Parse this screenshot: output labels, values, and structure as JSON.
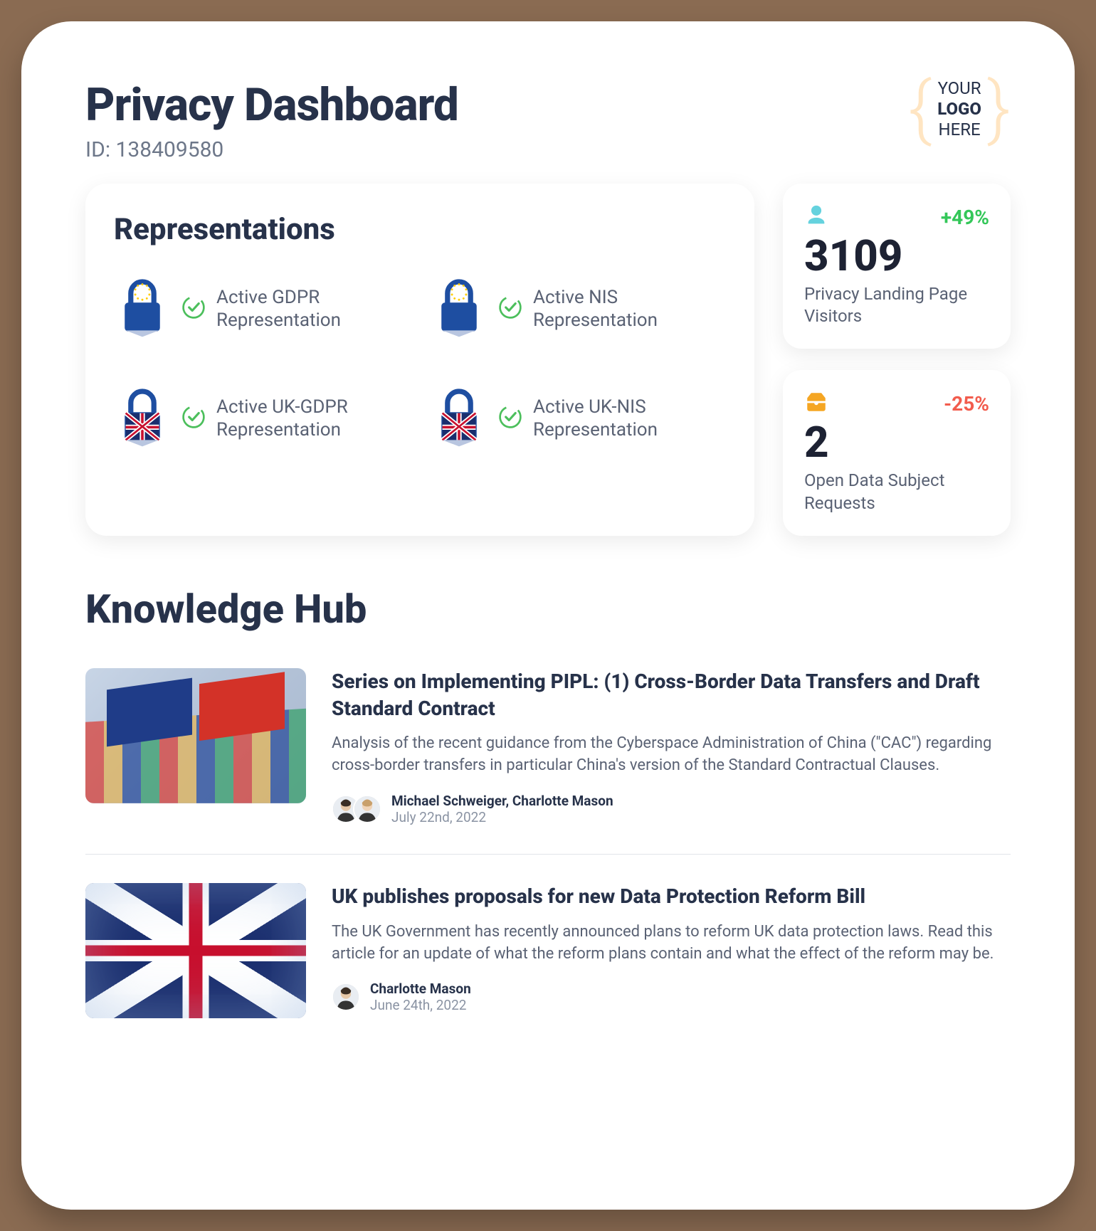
{
  "header": {
    "title": "Privacy Dashboard",
    "id_label": "ID: 138409580",
    "logo": {
      "line1": "YOUR",
      "line2": "LOGO",
      "line3": "HERE"
    }
  },
  "reps": {
    "title": "Representations",
    "items": [
      {
        "label": "Active GDPR Representation",
        "flag": "eu"
      },
      {
        "label": "Active NIS Representation",
        "flag": "eu"
      },
      {
        "label": "Active UK-GDPR Representation",
        "flag": "uk"
      },
      {
        "label": "Active UK-NIS Representation",
        "flag": "uk"
      }
    ]
  },
  "stats": [
    {
      "icon": "person",
      "delta": "+49%",
      "delta_dir": "up",
      "value": "3109",
      "label": "Privacy Landing Page Visitors"
    },
    {
      "icon": "inbox",
      "delta": "-25%",
      "delta_dir": "down",
      "value": "2",
      "label": "Open Data Subject Requests"
    }
  ],
  "hub": {
    "title": "Knowledge Hub",
    "articles": [
      {
        "title": "Series on Implementing PIPL: (1) Cross-Border Data Transfers and Draft Standard Contract",
        "desc": "Analysis of the recent guidance from the Cyberspace Administration of China (\"CAC\") regarding cross-border transfers in particular China's version of the Standard Contractual Clauses.",
        "authors": "Michael Schweiger, Charlotte Mason",
        "date": "July 22nd, 2022",
        "avatars": 2,
        "thumb": "containers"
      },
      {
        "title": "UK publishes proposals for new Data Protection Reform Bill",
        "desc": "The UK Government has recently announced plans to reform UK data protection laws. Read this article for an update of what the reform plans contain and what the effect of the reform may be.",
        "authors": "Charlotte Mason",
        "date": "June 24th, 2022",
        "avatars": 1,
        "thumb": "ukflag"
      }
    ]
  }
}
